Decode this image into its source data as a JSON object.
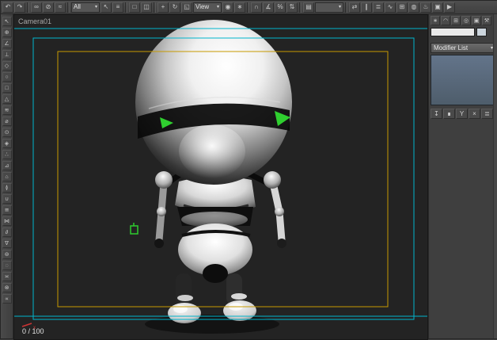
{
  "toolbar": {
    "items": [
      {
        "t": "i",
        "name": "undo-icon",
        "g": "↶"
      },
      {
        "t": "i",
        "name": "redo-icon",
        "g": "↷"
      },
      {
        "t": "s",
        "name": "toolbar-separator",
        "g": ""
      },
      {
        "t": "i",
        "name": "select-and-link-icon",
        "g": "∞"
      },
      {
        "t": "i",
        "name": "unlink-selection-icon",
        "g": "⊘"
      },
      {
        "t": "i",
        "name": "bind-to-space-warp-icon",
        "g": "≈"
      },
      {
        "t": "s",
        "name": "toolbar-separator",
        "g": ""
      },
      {
        "t": "d",
        "name": "selection-filter-dropdown",
        "g": "All"
      },
      {
        "t": "i",
        "name": "select-object-icon",
        "g": "↖"
      },
      {
        "t": "i",
        "name": "select-by-name-icon",
        "g": "≡"
      },
      {
        "t": "s",
        "name": "toolbar-separator",
        "g": ""
      },
      {
        "t": "i",
        "name": "rectangular-selection-region-icon",
        "g": "□"
      },
      {
        "t": "i",
        "name": "window-crossing-icon",
        "g": "◫"
      },
      {
        "t": "s",
        "name": "toolbar-separator",
        "g": ""
      },
      {
        "t": "i",
        "name": "select-and-move-icon",
        "g": "+"
      },
      {
        "t": "i",
        "name": "select-and-rotate-icon",
        "g": "↻"
      },
      {
        "t": "i",
        "name": "select-and-scale-icon",
        "g": "◱"
      },
      {
        "t": "d",
        "name": "reference-coordinate-dropdown",
        "g": "View"
      },
      {
        "t": "i",
        "name": "use-pivot-point-center-icon",
        "g": "◉"
      },
      {
        "t": "i",
        "name": "select-and-manipulate-icon",
        "g": "∗"
      },
      {
        "t": "s",
        "name": "toolbar-separator",
        "g": ""
      },
      {
        "t": "i",
        "name": "snaps-toggle-icon",
        "g": "∩"
      },
      {
        "t": "i",
        "name": "angle-snap-icon",
        "g": "∡"
      },
      {
        "t": "i",
        "name": "percent-snap-icon",
        "g": "%"
      },
      {
        "t": "i",
        "name": "spinner-snap-icon",
        "g": "⇅"
      },
      {
        "t": "s",
        "name": "toolbar-separator",
        "g": ""
      },
      {
        "t": "i",
        "name": "edit-named-selection-sets-icon",
        "g": "▤"
      },
      {
        "t": "d",
        "name": "named-selection-sets-dropdown",
        "g": ""
      },
      {
        "t": "s",
        "name": "toolbar-separator",
        "g": ""
      },
      {
        "t": "i",
        "name": "mirror-icon",
        "g": "⇄"
      },
      {
        "t": "i",
        "name": "align-icon",
        "g": "∥"
      },
      {
        "t": "i",
        "name": "layer-manager-icon",
        "g": "≣"
      },
      {
        "t": "i",
        "name": "curve-editor-icon",
        "g": "∿"
      },
      {
        "t": "i",
        "name": "schematic-view-icon",
        "g": "⊞"
      },
      {
        "t": "i",
        "name": "material-editor-icon",
        "g": "◍"
      },
      {
        "t": "i",
        "name": "render-setup-icon",
        "g": "♨"
      },
      {
        "t": "i",
        "name": "rendered-frame-window-icon",
        "g": "▣"
      },
      {
        "t": "i",
        "name": "quick-render-icon",
        "g": "▶"
      }
    ]
  },
  "left_toolbar": {
    "items": [
      {
        "name": "tool-icon",
        "g": "↖"
      },
      {
        "name": "tool-icon",
        "g": "⊕"
      },
      {
        "name": "tool-icon",
        "g": "∠"
      },
      {
        "name": "tool-icon",
        "g": "⊥"
      },
      {
        "name": "tool-icon",
        "g": "◇"
      },
      {
        "name": "tool-icon",
        "g": "○"
      },
      {
        "name": "tool-icon",
        "g": "□"
      },
      {
        "name": "tool-icon",
        "g": "△"
      },
      {
        "name": "tool-icon",
        "g": "≋"
      },
      {
        "name": "tool-icon",
        "g": "⌀"
      },
      {
        "name": "tool-icon",
        "g": "⊙"
      },
      {
        "name": "tool-icon",
        "g": "◈"
      },
      {
        "name": "tool-icon",
        "g": "∴"
      },
      {
        "name": "tool-icon",
        "g": "⊿"
      },
      {
        "name": "tool-icon",
        "g": "⌂"
      },
      {
        "name": "tool-icon",
        "g": "≬"
      },
      {
        "name": "tool-icon",
        "g": "∪"
      },
      {
        "name": "tool-icon",
        "g": "≅"
      },
      {
        "name": "tool-icon",
        "g": "⋈"
      },
      {
        "name": "tool-icon",
        "g": "∂"
      },
      {
        "name": "tool-icon",
        "g": "∇"
      },
      {
        "name": "tool-icon",
        "g": "⊚"
      },
      {
        "name": "tool-icon",
        "g": "◌"
      },
      {
        "name": "tool-icon",
        "g": "≍"
      },
      {
        "name": "tool-icon",
        "g": "⊗"
      },
      {
        "name": "tool-icon",
        "g": "∝"
      }
    ]
  },
  "viewport": {
    "label": "Camera01",
    "frame_counter": "0 / 100",
    "axis_label_x": "x"
  },
  "right_panel": {
    "tabs": [
      {
        "name": "tab-create-icon",
        "g": "∗"
      },
      {
        "name": "tab-modify-icon",
        "g": "◠"
      },
      {
        "name": "tab-hierarchy-icon",
        "g": "⊞"
      },
      {
        "name": "tab-motion-icon",
        "g": "◎"
      },
      {
        "name": "tab-display-icon",
        "g": "▣"
      },
      {
        "name": "tab-utilities-icon",
        "g": "⚒"
      }
    ],
    "object_name": {
      "value": "",
      "placeholder": ""
    },
    "modifier_list": {
      "label": "Modifier List"
    },
    "stack_buttons": [
      {
        "name": "pin-stack-button",
        "g": "↧"
      },
      {
        "name": "show-end-result-button",
        "g": "∎"
      },
      {
        "name": "make-unique-button",
        "g": "Y"
      },
      {
        "name": "remove-modifier-button",
        "g": "×"
      },
      {
        "name": "configure-modifier-sets-button",
        "g": "≣"
      }
    ]
  },
  "colors": {
    "frame_cyan": "#00b4cc",
    "frame_yellow": "#c79a00",
    "eye_green": "#2fcf2f",
    "helper_green": "#2ecc2e",
    "axis_red": "#cc3333"
  }
}
